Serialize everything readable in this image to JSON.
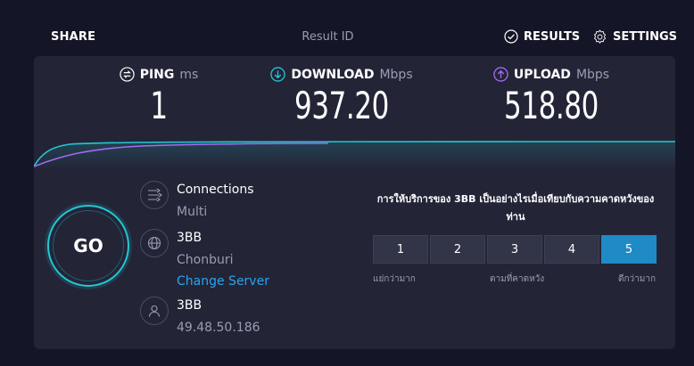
{
  "topbar": {
    "share": "SHARE",
    "result_id": "Result ID",
    "results": "RESULTS",
    "settings": "SETTINGS"
  },
  "metrics": {
    "ping": {
      "label": "PING",
      "unit": "ms",
      "value": "1"
    },
    "download": {
      "label": "DOWNLOAD",
      "unit": "Mbps",
      "value": "937.20"
    },
    "upload": {
      "label": "UPLOAD",
      "unit": "Mbps",
      "value": "518.80"
    }
  },
  "go": {
    "label": "GO"
  },
  "connections": {
    "title": "Connections",
    "mode": "Multi"
  },
  "server": {
    "name": "3BB",
    "location": "Chonburi",
    "change": "Change Server"
  },
  "provider": {
    "name": "3BB",
    "ip": "49.48.50.186"
  },
  "survey": {
    "question": "การให้บริการของ 3BB เป็นอย่างไรเมื่อเทียบกับความคาดหวังของท่าน",
    "options": [
      "1",
      "2",
      "3",
      "4",
      "5"
    ],
    "selected": "5",
    "low_label": "แย่กว่ามาก",
    "mid_label": "ตามที่คาดหวัง",
    "high_label": "ดีกว่ามาก"
  },
  "colors": {
    "background": "#141526",
    "card": "#232537",
    "download_accent": "#22c8d4",
    "upload_accent": "#a46bf0",
    "link": "#27a4f0",
    "selected_rating": "#1e8ac6"
  }
}
